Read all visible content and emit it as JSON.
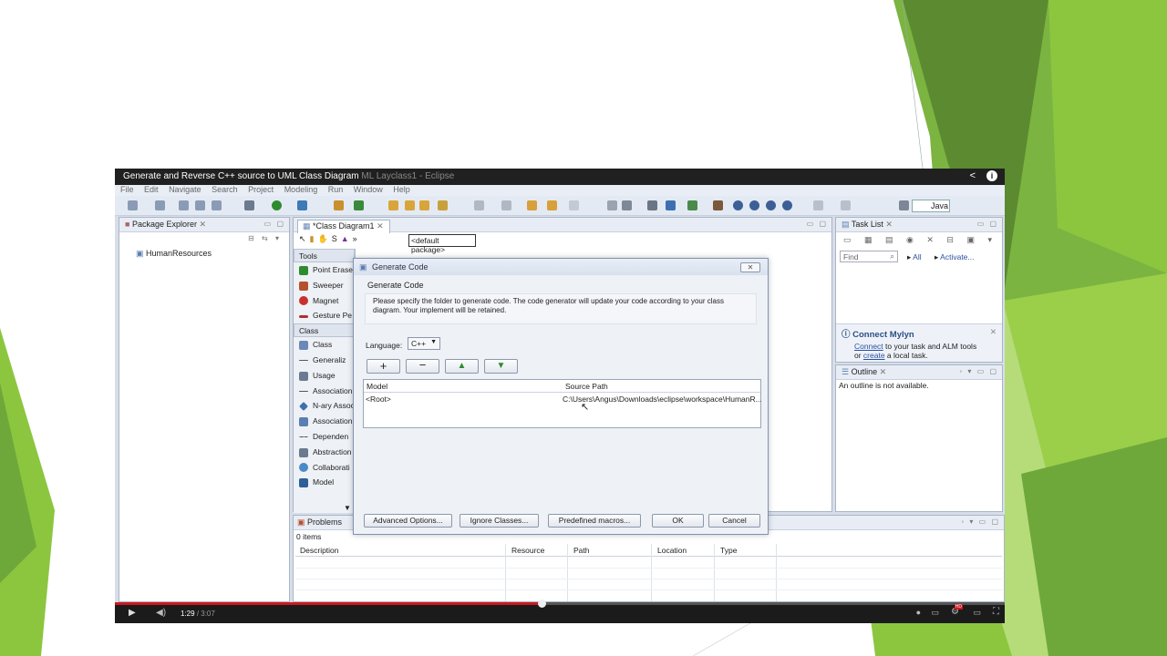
{
  "video": {
    "title": "Generate and Reverse C++ source to UML Class Diagram",
    "title_overlay": "ML Layclass1 - Eclipse",
    "share_icon": "share-icon",
    "info_icon": "info-icon",
    "current_time": "1:29",
    "duration": "/ 3:07",
    "progress_fraction": 0.479
  },
  "menu": [
    "File",
    "Edit",
    "Navigate",
    "Search",
    "Project",
    "Modeling",
    "Run",
    "Window",
    "Help"
  ],
  "perspective": "Java",
  "package_explorer": {
    "tab": "Package Explorer",
    "items": [
      "HumanResources"
    ]
  },
  "editor": {
    "tab": "*Class Diagram1",
    "package_selector": "<default package>",
    "palette_tools_label": "Tools",
    "palette_tools": [
      "Point Erase",
      "Sweeper",
      "Magnet",
      "Gesture Pe"
    ],
    "palette_class_label": "Class",
    "palette_class": [
      "Class",
      "Generaliz",
      "Usage",
      "Association",
      "N-ary Assoc",
      "Association",
      "Dependen",
      "Abstraction",
      "Collaborati",
      "Model"
    ]
  },
  "task_list": {
    "tab": "Task List",
    "find_placeholder": "Find",
    "all_label": "All",
    "activate_label": "Activate...",
    "mylyn_title": "Connect Mylyn",
    "mylyn_connect": "Connect",
    "mylyn_text1": " to your task and ALM tools",
    "mylyn_or": "or ",
    "mylyn_create": "create",
    "mylyn_text2": " a local task."
  },
  "outline": {
    "tab": "Outline",
    "message": "An outline is not available."
  },
  "problems": {
    "tab": "Problems",
    "count": "0 items",
    "columns": [
      "Description",
      "Resource",
      "Path",
      "Location",
      "Type"
    ]
  },
  "dialog": {
    "title": "Generate Code",
    "subtitle": "Generate Code",
    "description": "Please specify the folder to generate code. The code generator will update your code according to your class diagram. Your implement will be retained.",
    "language_label": "Language:",
    "language_value": "C++",
    "columns": [
      "Model",
      "Source Path"
    ],
    "rows": [
      {
        "model": "<Root>",
        "path": "C:\\Users\\Angus\\Downloads\\eclipse\\workspace\\HumanR..."
      }
    ],
    "buttons": {
      "advanced": "Advanced Options...",
      "ignore": "Ignore Classes...",
      "macros": "Predefined macros...",
      "ok": "OK",
      "cancel": "Cancel"
    }
  },
  "colors": {
    "green_dark": "#5a8a2e",
    "green_mid": "#7cb342",
    "green_light": "#a5d05a",
    "youtube_red": "#cc181e"
  }
}
